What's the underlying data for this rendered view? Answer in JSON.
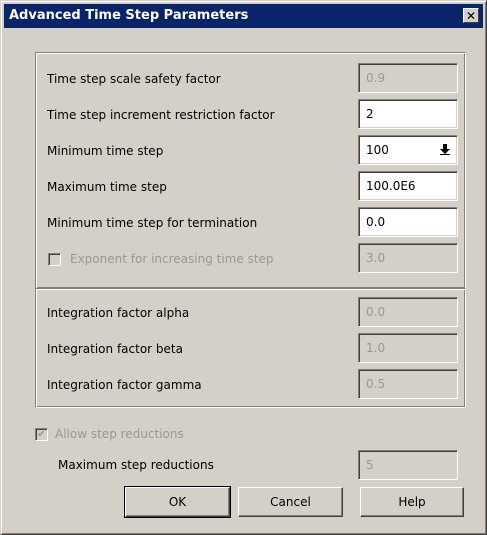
{
  "window": {
    "title": "Advanced Time Step Parameters",
    "close_symbol": "✕"
  },
  "group1": {
    "rows": [
      {
        "label": "Time step scale safety factor",
        "value": "0.9",
        "enabled": false
      },
      {
        "label": "Time step increment restriction factor",
        "value": "2",
        "enabled": true
      },
      {
        "label": "Minimum time step",
        "value": "100",
        "enabled": true,
        "dropdown": true
      },
      {
        "label": "Maximum time step",
        "value": "100.0E6",
        "enabled": true
      },
      {
        "label": "Minimum time step for termination",
        "value": "0.0",
        "enabled": true
      },
      {
        "label": "Exponent for increasing time step",
        "value": "3.0",
        "enabled": false,
        "checkbox": true,
        "checked": false
      }
    ]
  },
  "group2": {
    "rows": [
      {
        "label": "Integration factor alpha",
        "value": "0.0",
        "enabled": false
      },
      {
        "label": "Integration factor beta",
        "value": "1.0",
        "enabled": false
      },
      {
        "label": "Integration factor gamma",
        "value": "0.5",
        "enabled": false
      }
    ]
  },
  "reductions": {
    "allow_label": "Allow step reductions",
    "allow_checked": true,
    "allow_enabled": false,
    "max_label": "Maximum step reductions",
    "max_value": "5"
  },
  "buttons": {
    "ok": "OK",
    "cancel": "Cancel",
    "help": "Help"
  },
  "icons": {
    "dropdown": "down-arrow-icon",
    "close": "close-icon",
    "check": "checkmark-icon"
  }
}
